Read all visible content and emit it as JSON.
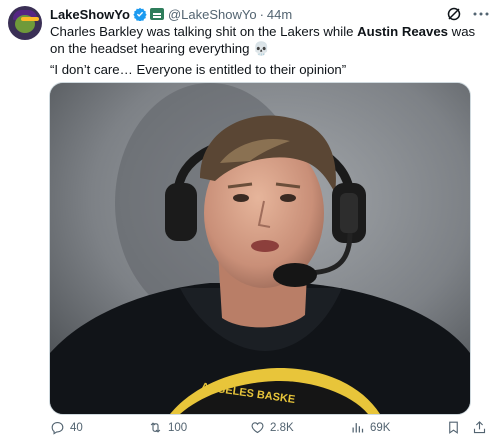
{
  "author": {
    "display_name": "LakeShowYo",
    "handle": "@LakeShowYo",
    "separator": "·",
    "time": "44m"
  },
  "tweet": {
    "text_before": "Charles Barkley was talking shit on the Lakers while ",
    "text_bold": "Austin Reaves",
    "text_after": " was on the headset hearing everything ",
    "emoji": "💀",
    "quote": "“I don’t care… Everyone is entitled to their opinion”"
  },
  "media": {
    "jersey_text": "ANGELES BASKE"
  },
  "actions": {
    "replies": "40",
    "reposts": "100",
    "likes": "2.8K",
    "views": "69K"
  },
  "colors": {
    "text": "#0f1419",
    "muted": "#536471",
    "verified": "#1d9bf0"
  }
}
